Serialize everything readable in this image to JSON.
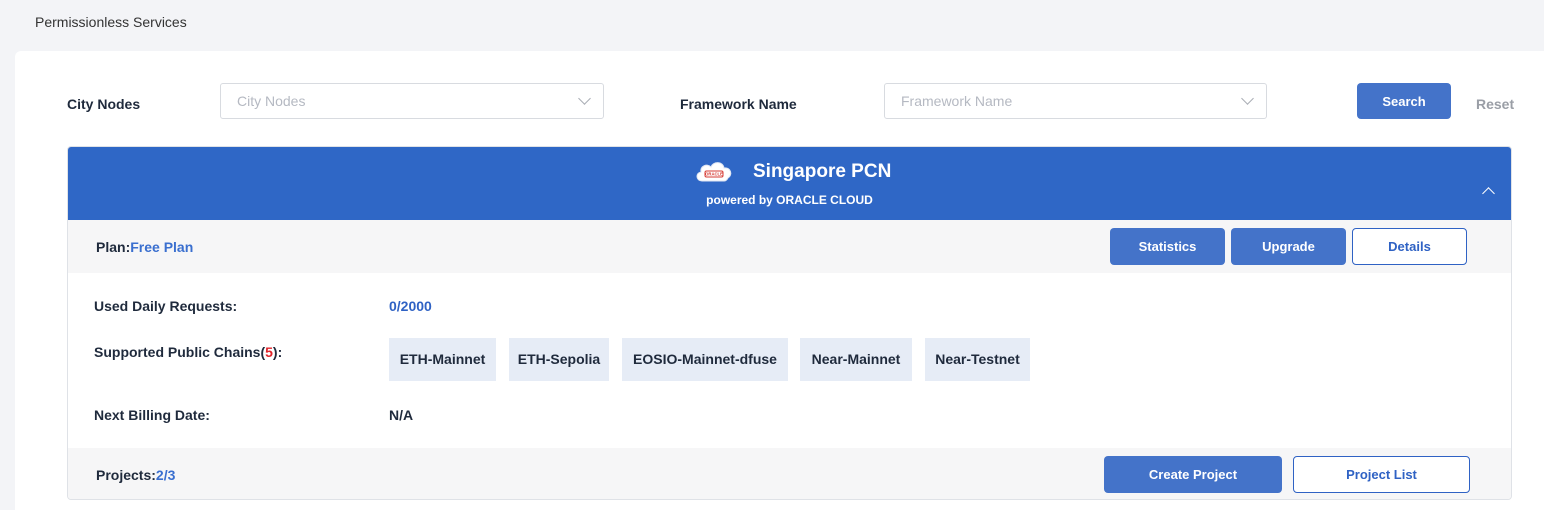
{
  "breadcrumb": "Permissionless Services",
  "filters": {
    "city_label": "City Nodes",
    "city_placeholder": "City Nodes",
    "framework_label": "Framework Name",
    "framework_placeholder": "Framework Name",
    "search_label": "Search",
    "reset_label": "Reset"
  },
  "card": {
    "title": "Singapore PCN",
    "subtitle": "powered by ORACLE CLOUD",
    "logo_text": "ORACLE",
    "plan_label": "Plan:",
    "plan_value": "Free Plan",
    "statistics_label": "Statistics",
    "upgrade_label": "Upgrade",
    "details_label": "Details",
    "used_requests_label": "Used Daily Requests:",
    "used_requests_value": "0/2000",
    "chains_label_prefix": "Supported Public Chains(",
    "chains_count": "5",
    "chains_label_suffix": "):",
    "chains": [
      "ETH-Mainnet",
      "ETH-Sepolia",
      "EOSIO-Mainnet-dfuse",
      "Near-Mainnet",
      "Near-Testnet"
    ],
    "billing_label": "Next Billing Date:",
    "billing_value": "N/A",
    "projects_label": "Projects:",
    "projects_value": "2/3",
    "create_project_label": "Create Project",
    "project_list_label": "Project List"
  },
  "colors": {
    "accent": "#2f67c6",
    "button": "#4473c9",
    "chain_bg": "#e6ecf6",
    "count_red": "#e0242b"
  }
}
